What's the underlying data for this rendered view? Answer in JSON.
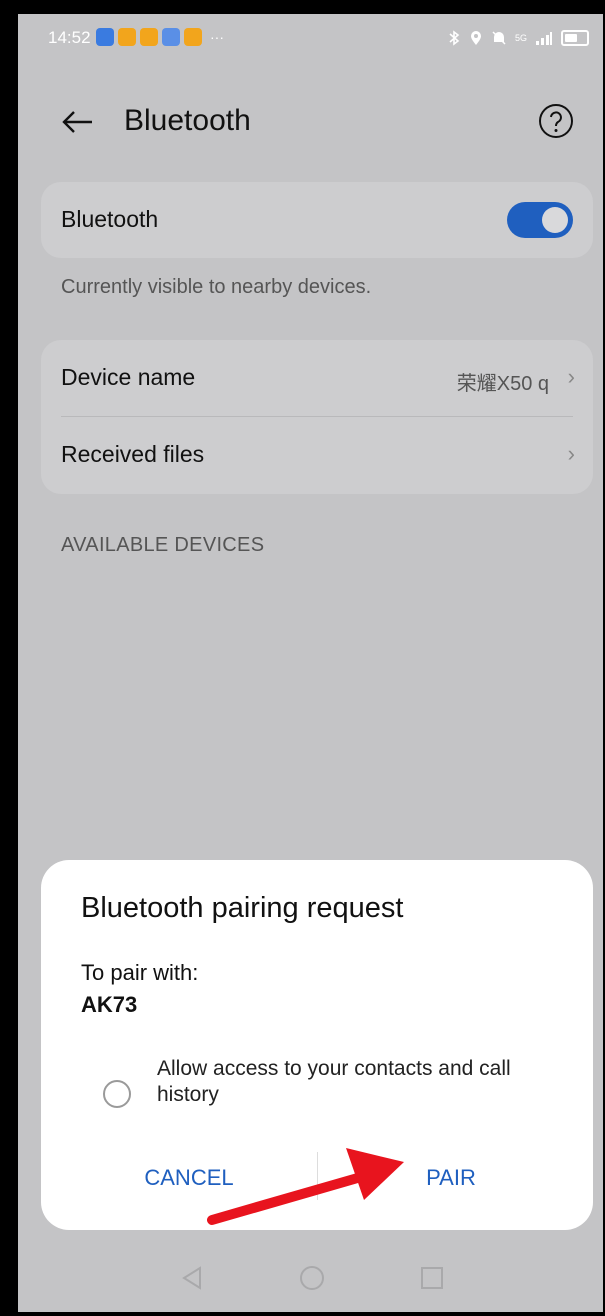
{
  "status_bar": {
    "time": "14:52",
    "more": "···",
    "signal_label": "5G"
  },
  "header": {
    "title": "Bluetooth",
    "back_icon": "arrow-left-icon",
    "help_icon": "question-circle-icon"
  },
  "bluetooth_toggle": {
    "label": "Bluetooth",
    "state": "on",
    "color": "#1f5fbf"
  },
  "visibility_note": "Currently visible to nearby devices.",
  "settings": {
    "device_name_label": "Device name",
    "device_name_value": "荣耀X50 q",
    "received_files_label": "Received files"
  },
  "available_devices_header": "AVAILABLE DEVICES",
  "dialog": {
    "title": "Bluetooth pairing request",
    "pair_with_label": "To pair with:",
    "device": "AK73",
    "checkbox_label": "Allow access to your contacts and call history",
    "checkbox_checked": false,
    "cancel_label": "CANCEL",
    "pair_label": "PAIR"
  },
  "annotation": {
    "arrow_color": "#e8141e",
    "points_to": "pair-button"
  }
}
